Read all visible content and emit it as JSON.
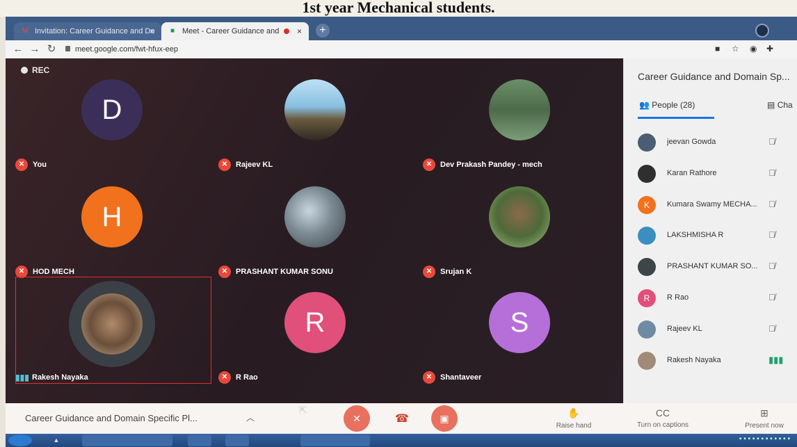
{
  "caption": "1st year Mechanical students.",
  "browser": {
    "tabs": [
      {
        "label": "Invitation: Career Guidance and Do",
        "icon": "gmail-icon",
        "close": "×"
      },
      {
        "label": "Meet - Career Guidance and",
        "icon": "meet-icon",
        "close": "×"
      }
    ],
    "new_tab": "+",
    "url": "meet.google.com/fwt-hfux-eep"
  },
  "meet": {
    "rec_label": "REC",
    "tiles": [
      {
        "name": "You",
        "initial": "D",
        "color": "#3b2f5a",
        "muted": true
      },
      {
        "name": "Rajeev KL",
        "initial": "",
        "muted": true
      },
      {
        "name": "Dev Prakash Pandey - mech",
        "initial": "",
        "muted": true
      },
      {
        "name": "HOD MECH",
        "initial": "H",
        "color": "#f2711c",
        "muted": true
      },
      {
        "name": "PRASHANT KUMAR SONU",
        "initial": "",
        "muted": true
      },
      {
        "name": "Srujan K",
        "initial": "",
        "muted": true
      },
      {
        "name": "Rakesh Nayaka",
        "initial": "",
        "muted": false
      },
      {
        "name": "R Rao",
        "initial": "R",
        "color": "#e0507a",
        "muted": true
      },
      {
        "name": "Shantaveer",
        "initial": "S",
        "color": "#b66fd8",
        "muted": true
      }
    ]
  },
  "panel": {
    "title": "Career Guidance and Domain Sp...",
    "people_tab": "People (28)",
    "chat_tab": "Cha",
    "people": [
      {
        "name": "jeevan Gowda",
        "initial": "",
        "color": "#4a5d73"
      },
      {
        "name": "Karan Rathore",
        "initial": "",
        "color": "#2f2f2f"
      },
      {
        "name": "Kumara Swamy MECHA...",
        "initial": "K",
        "color": "#f2711c"
      },
      {
        "name": "LAKSHMISHA R",
        "initial": "",
        "color": "#3a8fc0"
      },
      {
        "name": "PRASHANT KUMAR SO...",
        "initial": "",
        "color": "#3d4549"
      },
      {
        "name": "R Rao",
        "initial": "R",
        "color": "#e0507a"
      },
      {
        "name": "Rajeev KL",
        "initial": "",
        "color": "#6f8aa3"
      },
      {
        "name": "Rakesh Nayaka",
        "initial": "",
        "color": "#a08b78",
        "speaking": true
      }
    ]
  },
  "bottom": {
    "meeting_title": "Career Guidance and Domain Specific Pl...",
    "raise_hand": "Raise hand",
    "captions": "Turn on captions",
    "present": "Present now"
  }
}
